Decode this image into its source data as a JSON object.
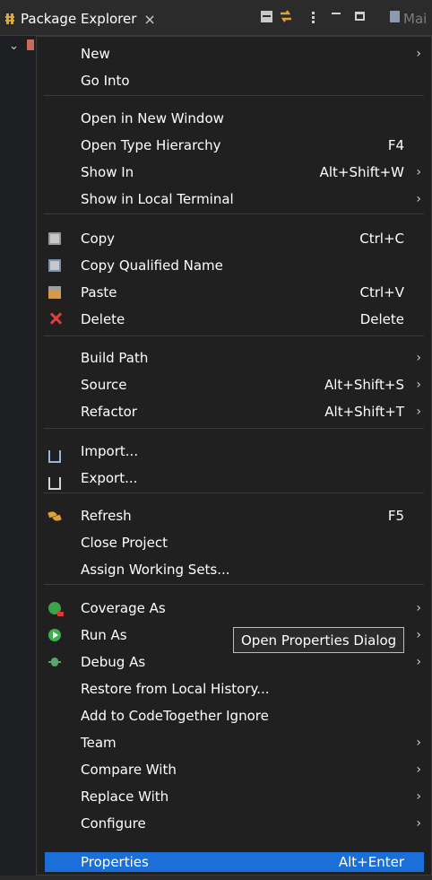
{
  "tabbar": {
    "tab_label": "Package Explorer",
    "tab_close": "×",
    "second_tab_label": "Mai"
  },
  "tree": {
    "chevron": "⌄"
  },
  "menu": {
    "items": [
      {
        "id": "new",
        "label": "New",
        "shortcut": "",
        "submenu": true,
        "icon": ""
      },
      {
        "id": "go-into",
        "label": "Go Into",
        "shortcut": "",
        "submenu": false,
        "icon": ""
      },
      {
        "id": "open-new-window",
        "label": "Open in New Window",
        "shortcut": "",
        "submenu": false,
        "icon": ""
      },
      {
        "id": "open-type-hierarchy",
        "label": "Open Type Hierarchy",
        "shortcut": "F4",
        "submenu": false,
        "icon": ""
      },
      {
        "id": "show-in",
        "label": "Show In",
        "shortcut": "Alt+Shift+W",
        "submenu": true,
        "icon": ""
      },
      {
        "id": "show-local-terminal",
        "label": "Show in Local Terminal",
        "shortcut": "",
        "submenu": true,
        "icon": ""
      },
      {
        "id": "copy",
        "label": "Copy",
        "shortcut": "Ctrl+C",
        "submenu": false,
        "icon": "copy-icon"
      },
      {
        "id": "copy-qualified-name",
        "label": "Copy Qualified Name",
        "shortcut": "",
        "submenu": false,
        "icon": "copy-qualified-icon"
      },
      {
        "id": "paste",
        "label": "Paste",
        "shortcut": "Ctrl+V",
        "submenu": false,
        "icon": "paste-icon"
      },
      {
        "id": "delete",
        "label": "Delete",
        "shortcut": "Delete",
        "submenu": false,
        "icon": "delete-icon"
      },
      {
        "id": "build-path",
        "label": "Build Path",
        "shortcut": "",
        "submenu": true,
        "icon": ""
      },
      {
        "id": "source",
        "label": "Source",
        "shortcut": "Alt+Shift+S",
        "submenu": true,
        "icon": ""
      },
      {
        "id": "refactor",
        "label": "Refactor",
        "shortcut": "Alt+Shift+T",
        "submenu": true,
        "icon": ""
      },
      {
        "id": "import",
        "label": "Import...",
        "shortcut": "",
        "submenu": false,
        "icon": "import-icon"
      },
      {
        "id": "export",
        "label": "Export...",
        "shortcut": "",
        "submenu": false,
        "icon": "export-icon"
      },
      {
        "id": "refresh",
        "label": "Refresh",
        "shortcut": "F5",
        "submenu": false,
        "icon": "refresh-icon"
      },
      {
        "id": "close-project",
        "label": "Close Project",
        "shortcut": "",
        "submenu": false,
        "icon": ""
      },
      {
        "id": "assign-working-sets",
        "label": "Assign Working Sets...",
        "shortcut": "",
        "submenu": false,
        "icon": ""
      },
      {
        "id": "coverage-as",
        "label": "Coverage As",
        "shortcut": "",
        "submenu": true,
        "icon": "coverage-icon"
      },
      {
        "id": "run-as",
        "label": "Run As",
        "shortcut": "",
        "submenu": true,
        "icon": "run-icon"
      },
      {
        "id": "debug-as",
        "label": "Debug As",
        "shortcut": "",
        "submenu": true,
        "icon": "debug-icon"
      },
      {
        "id": "restore-local-history",
        "label": "Restore from Local History...",
        "shortcut": "",
        "submenu": false,
        "icon": ""
      },
      {
        "id": "add-codetogether-ignore",
        "label": "Add to CodeTogether Ignore",
        "shortcut": "",
        "submenu": false,
        "icon": ""
      },
      {
        "id": "team",
        "label": "Team",
        "shortcut": "",
        "submenu": true,
        "icon": ""
      },
      {
        "id": "compare-with",
        "label": "Compare With",
        "shortcut": "",
        "submenu": true,
        "icon": ""
      },
      {
        "id": "replace-with",
        "label": "Replace With",
        "shortcut": "",
        "submenu": true,
        "icon": ""
      },
      {
        "id": "configure",
        "label": "Configure",
        "shortcut": "",
        "submenu": true,
        "icon": ""
      },
      {
        "id": "properties",
        "label": "Properties",
        "shortcut": "Alt+Enter",
        "submenu": false,
        "icon": "",
        "selected": true
      }
    ],
    "arrow": "›"
  },
  "tooltip": {
    "text": "Open Properties Dialog"
  },
  "colors": {
    "menu_bg": "#202020",
    "selection": "#1a6fd8",
    "separator": "#3a3a3a",
    "text": "#ffffff"
  }
}
